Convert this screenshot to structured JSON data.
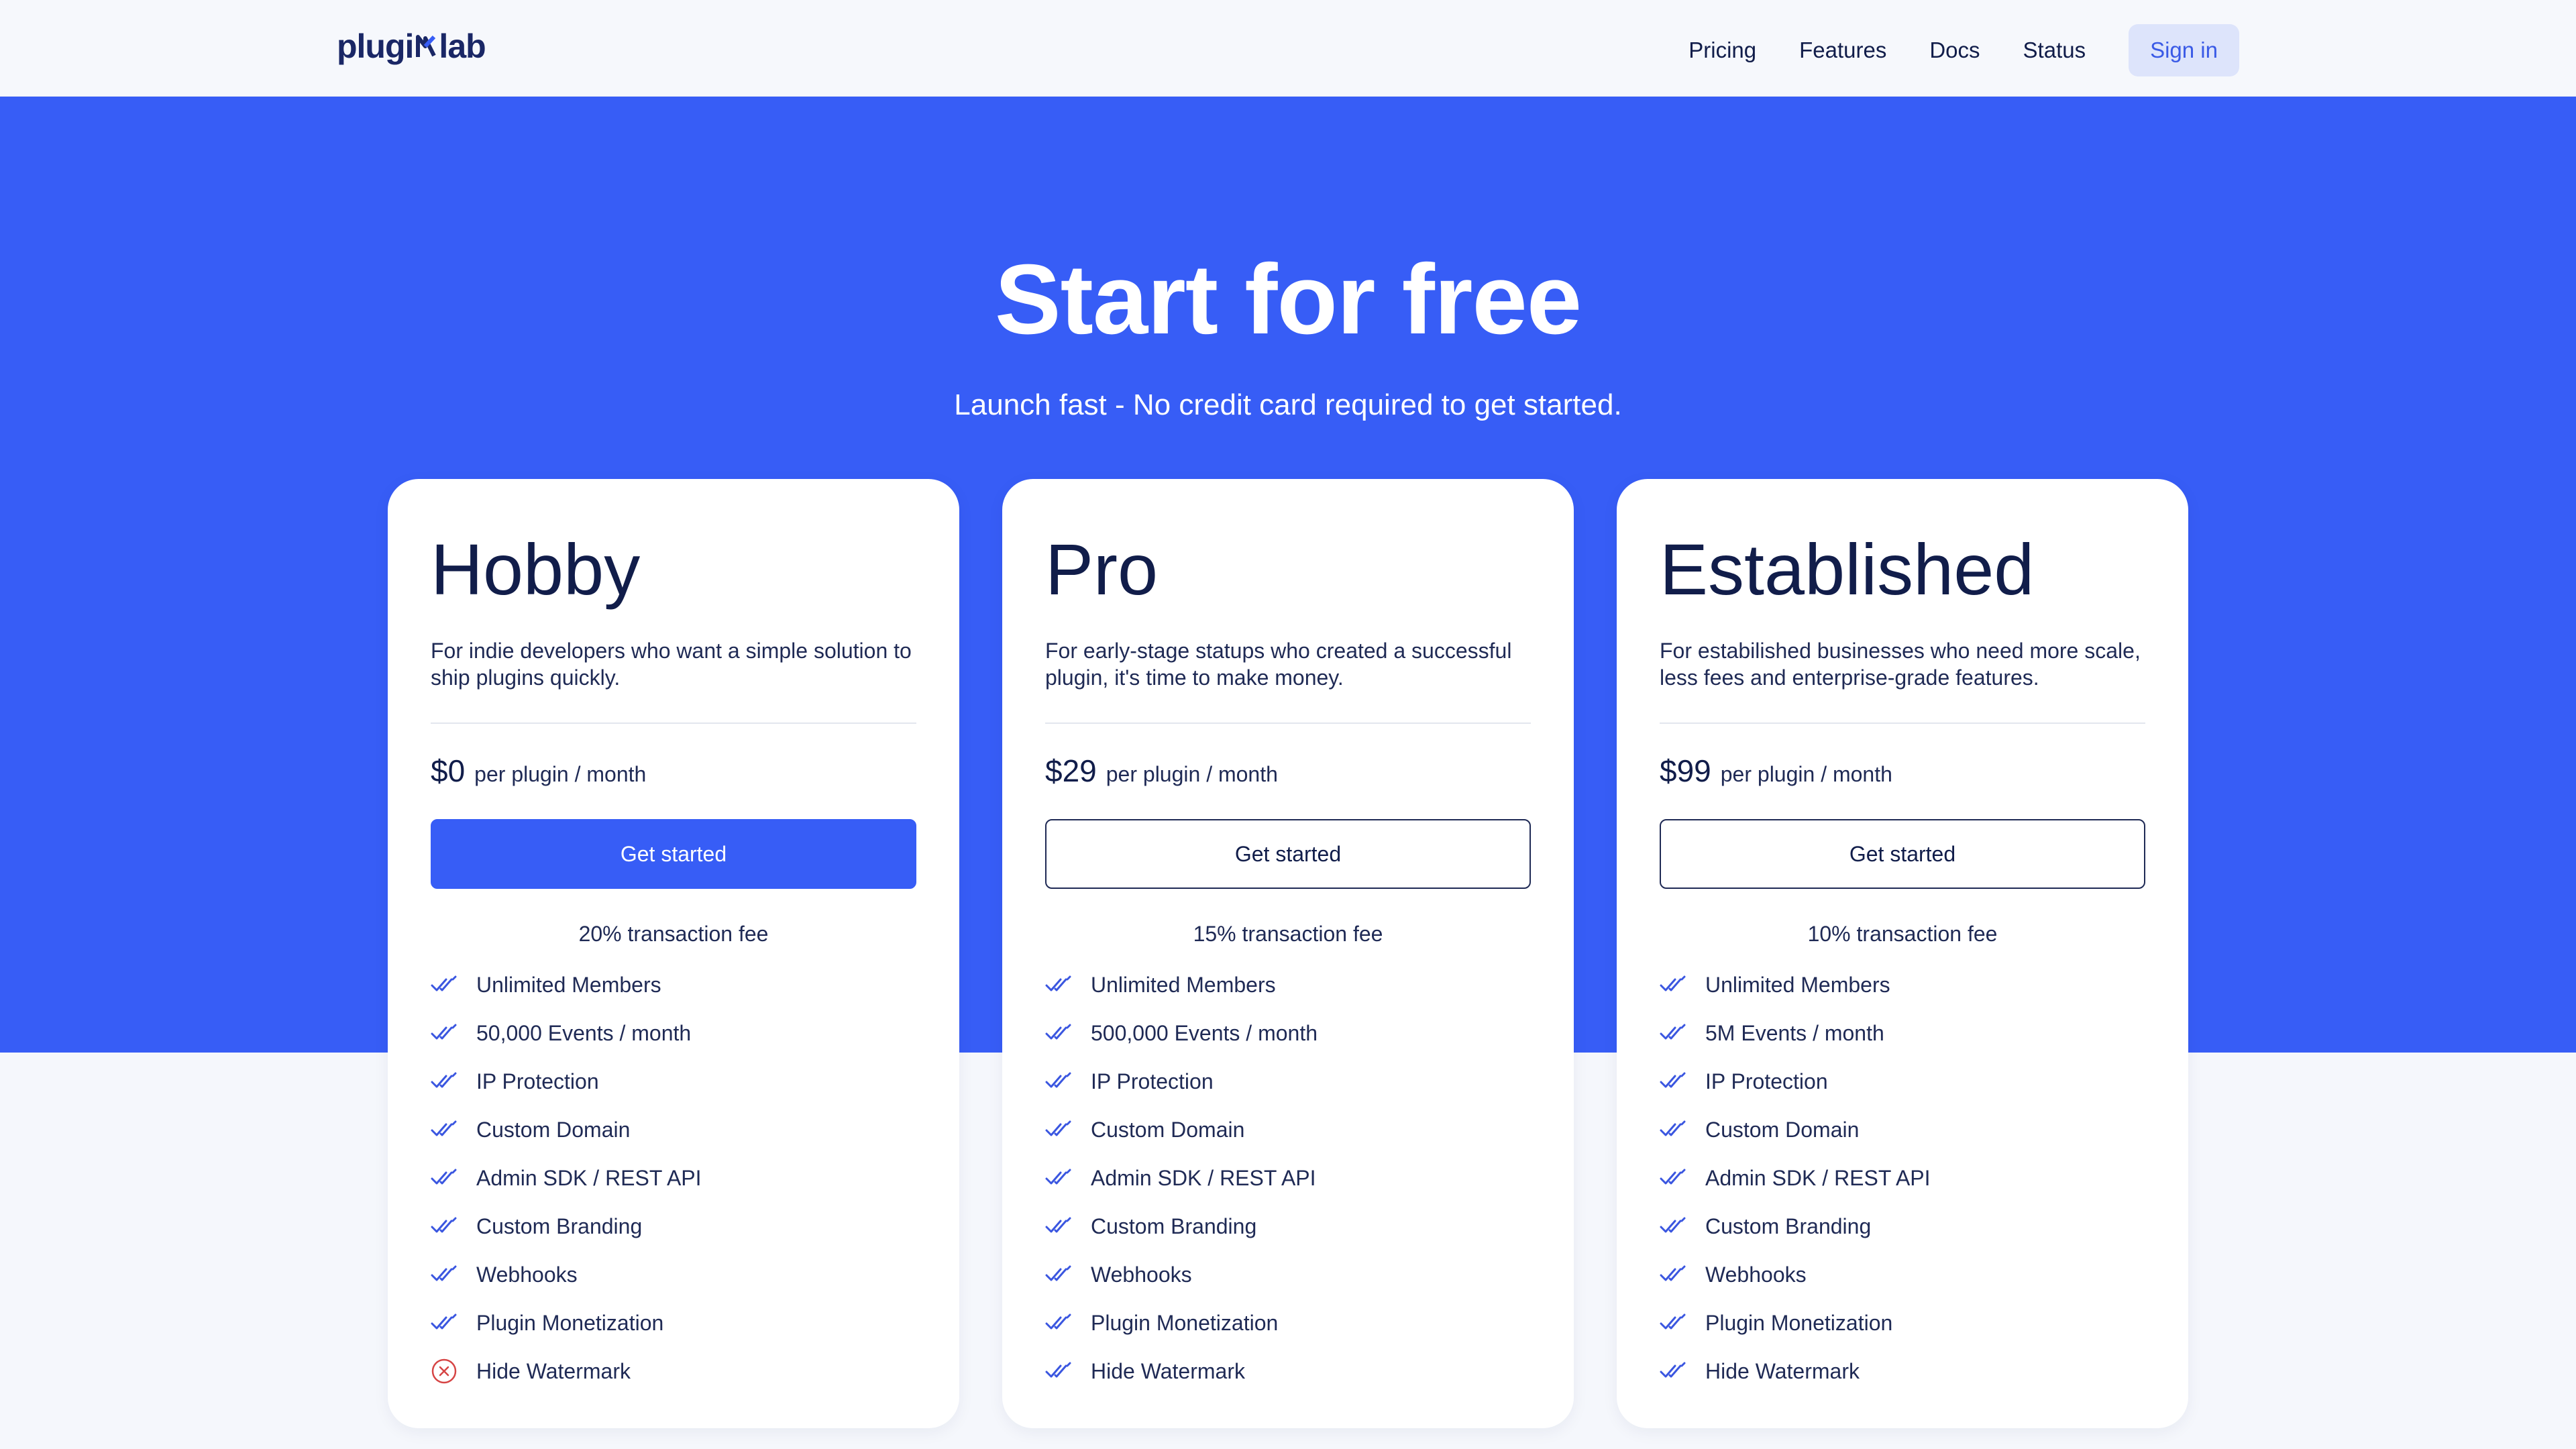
{
  "nav": {
    "logo_text_left": "plugi",
    "logo_text_right": "lab",
    "links": [
      "Pricing",
      "Features",
      "Docs",
      "Status"
    ],
    "signin_label": "Sign in"
  },
  "hero": {
    "title": "Start for free",
    "subtitle": "Launch fast - No credit card required to get started."
  },
  "colors": {
    "brand_blue": "#375DF6",
    "navy_text": "#111D4A",
    "check_icon": "#3A56E0",
    "cross_icon": "#D64545"
  },
  "plans": [
    {
      "name": "Hobby",
      "description": "For indie developers who want a simple solution to ship plugins quickly.",
      "price": "$0",
      "price_unit": "per plugin / month",
      "cta_label": "Get started",
      "cta_style": "primary",
      "fee": "20% transaction fee",
      "features": [
        {
          "label": "Unlimited Members",
          "icon": "double-check-icon"
        },
        {
          "label": "50,000 Events / month",
          "icon": "double-check-icon"
        },
        {
          "label": "IP Protection",
          "icon": "double-check-icon"
        },
        {
          "label": "Custom Domain",
          "icon": "double-check-icon"
        },
        {
          "label": "Admin SDK / REST API",
          "icon": "double-check-icon"
        },
        {
          "label": "Custom Branding",
          "icon": "double-check-icon"
        },
        {
          "label": "Webhooks",
          "icon": "double-check-icon"
        },
        {
          "label": "Plugin Monetization",
          "icon": "double-check-icon"
        },
        {
          "label": "Hide Watermark",
          "icon": "x-circle-icon"
        }
      ]
    },
    {
      "name": "Pro",
      "description": "For early-stage statups who created a successful plugin, it's time to make money.",
      "price": "$29",
      "price_unit": "per plugin / month",
      "cta_label": "Get started",
      "cta_style": "outline",
      "fee": "15% transaction fee",
      "features": [
        {
          "label": "Unlimited Members",
          "icon": "double-check-icon"
        },
        {
          "label": "500,000 Events / month",
          "icon": "double-check-icon"
        },
        {
          "label": "IP Protection",
          "icon": "double-check-icon"
        },
        {
          "label": "Custom Domain",
          "icon": "double-check-icon"
        },
        {
          "label": "Admin SDK / REST API",
          "icon": "double-check-icon"
        },
        {
          "label": "Custom Branding",
          "icon": "double-check-icon"
        },
        {
          "label": "Webhooks",
          "icon": "double-check-icon"
        },
        {
          "label": "Plugin Monetization",
          "icon": "double-check-icon"
        },
        {
          "label": "Hide Watermark",
          "icon": "double-check-icon"
        }
      ]
    },
    {
      "name": "Established",
      "description": "For estabilished businesses who need more scale, less fees and enterprise-grade features.",
      "price": "$99",
      "price_unit": "per plugin / month",
      "cta_label": "Get started",
      "cta_style": "outline",
      "fee": "10% transaction fee",
      "features": [
        {
          "label": "Unlimited Members",
          "icon": "double-check-icon"
        },
        {
          "label": "5M Events / month",
          "icon": "double-check-icon"
        },
        {
          "label": "IP Protection",
          "icon": "double-check-icon"
        },
        {
          "label": "Custom Domain",
          "icon": "double-check-icon"
        },
        {
          "label": "Admin SDK / REST API",
          "icon": "double-check-icon"
        },
        {
          "label": "Custom Branding",
          "icon": "double-check-icon"
        },
        {
          "label": "Webhooks",
          "icon": "double-check-icon"
        },
        {
          "label": "Plugin Monetization",
          "icon": "double-check-icon"
        },
        {
          "label": "Hide Watermark",
          "icon": "double-check-icon"
        }
      ]
    }
  ]
}
